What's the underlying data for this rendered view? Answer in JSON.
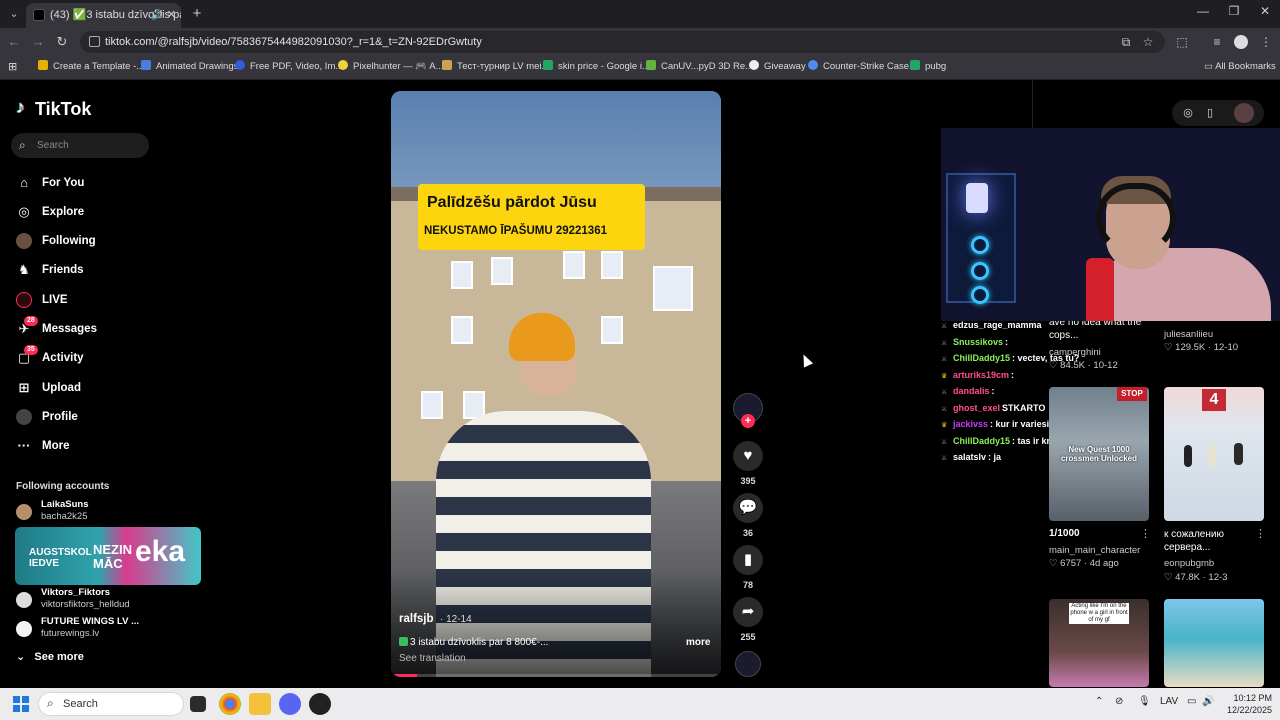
{
  "browser": {
    "tab_title": "(43) ✅3 istabu dzīvoklis pa",
    "url": "tiktok.com/@ralfsjb/video/7583675444982091030?_r=1&_t=ZN-92EDrGwtuty",
    "bookmarks": [
      "Create a Template -...",
      "Animated Drawings",
      "Free PDF, Video, Im...",
      "Pixelhunter — 🎮 A...",
      "Тест-турнир LV mei...",
      "skin price - Google i...",
      "CanUV...pyD 3D Re...",
      "Giveaway",
      "Counter-Strike Case...",
      "pubg"
    ],
    "all_bookmarks": "All Bookmarks"
  },
  "sidebar": {
    "logo": "TikTok",
    "search_placeholder": "Search",
    "nav": [
      {
        "label": "For You",
        "icon": "home-icon",
        "glyph": "⌂"
      },
      {
        "label": "Explore",
        "icon": "compass-icon",
        "glyph": "◎"
      },
      {
        "label": "Following",
        "icon": "following-avatar-icon",
        "glyph": "●"
      },
      {
        "label": "Friends",
        "icon": "friends-icon",
        "glyph": "♞"
      },
      {
        "label": "LIVE",
        "icon": "live-icon",
        "glyph": "◉"
      },
      {
        "label": "Messages",
        "icon": "messages-icon",
        "glyph": "✈",
        "badge": "28"
      },
      {
        "label": "Activity",
        "icon": "activity-icon",
        "glyph": "▢",
        "badge": "35"
      },
      {
        "label": "Upload",
        "icon": "upload-icon",
        "glyph": "⊞"
      },
      {
        "label": "Profile",
        "icon": "profile-icon",
        "glyph": "●"
      },
      {
        "label": "More",
        "icon": "more-icon",
        "glyph": "···"
      }
    ],
    "following_title": "Following accounts",
    "following": [
      {
        "name": "LaikaSuns",
        "handle": "bacha2k25"
      },
      {
        "name": "Viktors_Fiktors",
        "handle": "viktorsfiktors_helldud"
      },
      {
        "name": "FUTURE WINGS LV ...",
        "handle": "futurewings.lv"
      }
    ],
    "banner": {
      "t1": "AUGSTSKOL",
      "t1b": "IEDVE",
      "t2": "NEZIN",
      "t2b": "MĀC",
      "t3": "eka"
    },
    "see_more": "See more"
  },
  "video": {
    "overlay_line1": "Palīdzēšu pārdot Jūsu",
    "overlay_line2": "NEKUSTAMO ĪPAŠUMU 29221361",
    "author": "ralfsjb",
    "date": "· 12-14",
    "description": "3 istabu dzīvoklis par 8 800€-...",
    "more": "more",
    "see_translation": "See translation",
    "progress": 0.08
  },
  "actions": {
    "likes": "395",
    "comments": "36",
    "saves": "78",
    "shares": "255"
  },
  "chat": [
    {
      "user": "edzus_rage_mamma",
      "text": "",
      "color": "#ffffff",
      "icon": "sword-icon"
    },
    {
      "user": "Snussikovs",
      "text": ":",
      "color": "#8cf05a",
      "icon": "sword-icon"
    },
    {
      "user": "ChillDaddy15",
      "text": ": vectev, tas tu?",
      "color": "#8cf05a",
      "icon": "sword-icon"
    },
    {
      "user": "arturiks19cm",
      "text": ":",
      "color": "#ff4f8b",
      "icon": "crown-icon"
    },
    {
      "user": "dandalis",
      "text": ":",
      "color": "#ff4f8b",
      "icon": "sword-icon"
    },
    {
      "user": "ghost_exel",
      "text": "STKARTO",
      "color": "#ff4f8b",
      "icon": "sword-icon"
    },
    {
      "user": "jackivss",
      "text": ": kur ir variesi",
      "color": "#c73bff",
      "icon": "crown-icon"
    },
    {
      "user": "ChillDaddy15",
      "text": ": tas ir krievija",
      "color": "#8cf05a",
      "icon": "sword-icon"
    },
    {
      "user": "salatslv",
      "text": ": ja",
      "color": "#ffffff",
      "icon": "sword-icon"
    }
  ],
  "grid": [
    {
      "title": "ave no idea what the cops...",
      "author": "camperghini",
      "stats": "84.5K · 10-12"
    },
    {
      "title": "",
      "author": "juliesanliieu",
      "stats": "129.5K · 12-10"
    },
    {
      "title": "1/1000",
      "author": "main_main_character",
      "stats": "6757 · 4d ago",
      "thumb_text": "New Quest 1000 crossmen Unlocked",
      "sign": "STOP"
    },
    {
      "title": "к сожалению сервера...",
      "author": "eonpubgmb",
      "stats": "47.8K · 12-3",
      "thumb_text": "4"
    },
    {
      "thumb_text": "Acting like I'm on the phone w a girl in front of my gf"
    },
    {
      "thumb_text": ""
    }
  ],
  "taskbar": {
    "search": "Search",
    "lang": "LAV",
    "time": "10:12 PM",
    "date": "12/22/2025"
  },
  "colors": {
    "accent": "#fe2c55",
    "caption_bg": "#fcd50f"
  }
}
